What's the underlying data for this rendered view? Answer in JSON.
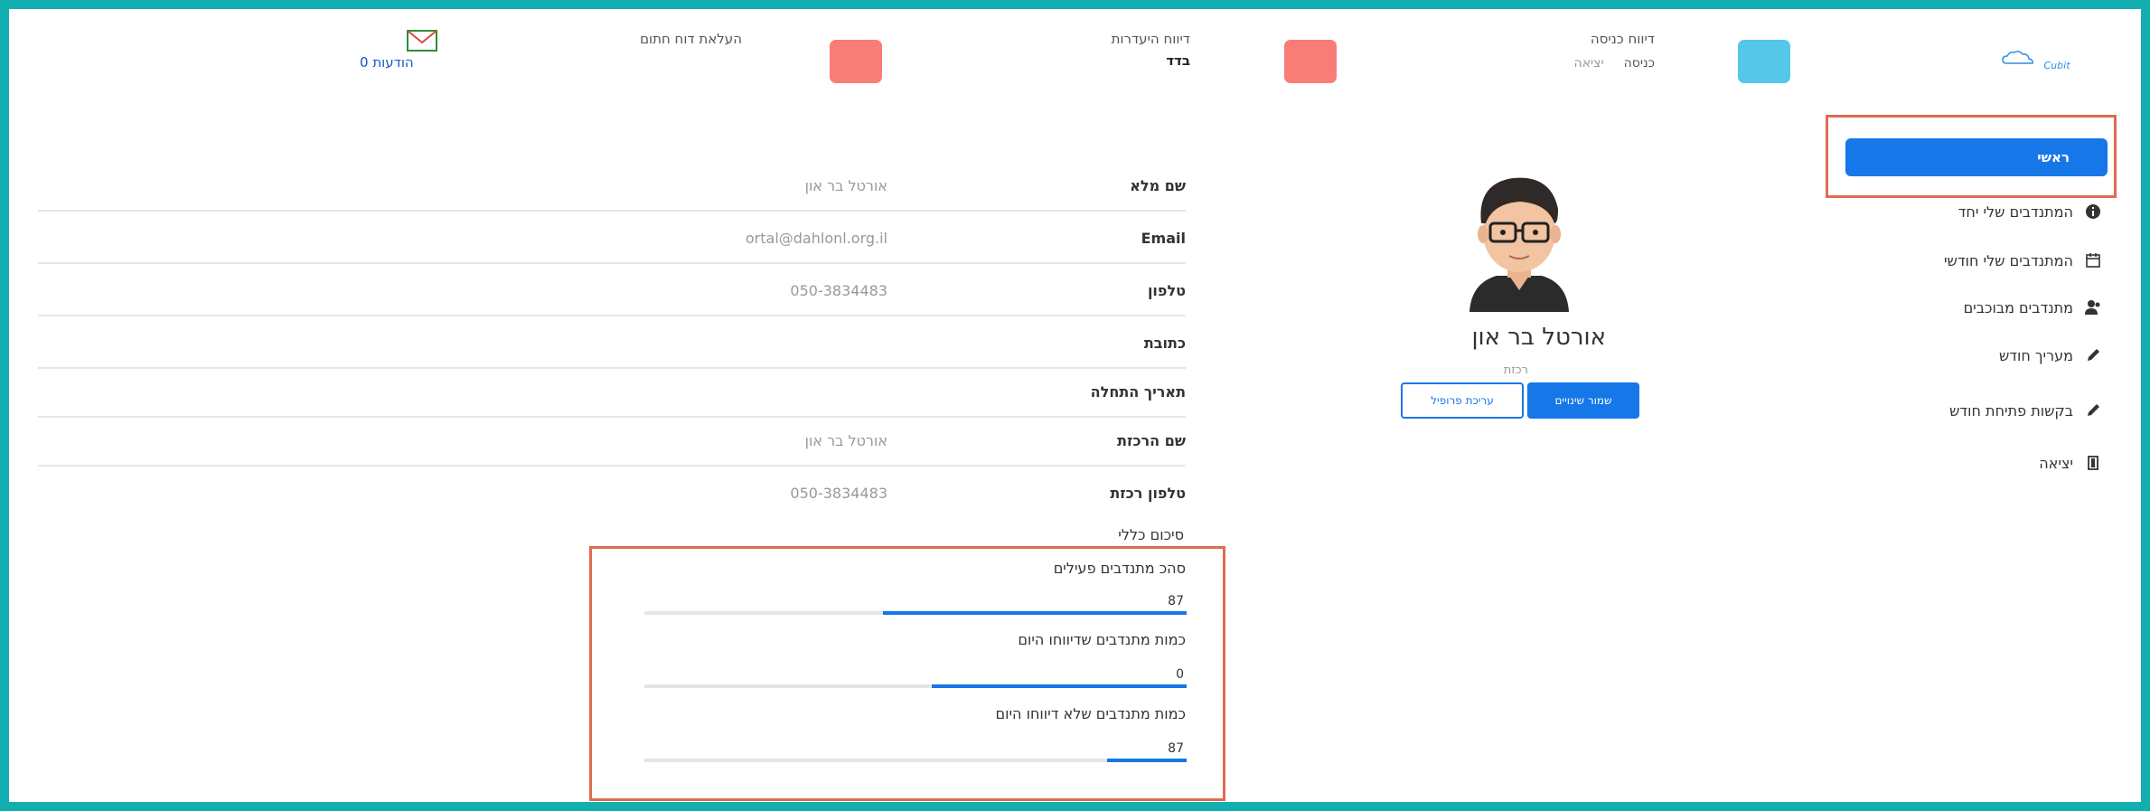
{
  "header": {
    "logo": "Cubit",
    "entry_report": {
      "label": "דיווח כניסה",
      "options": [
        "כניסה",
        "יציאה"
      ]
    },
    "absence_report": {
      "label": "דיווח היעדרות",
      "value": "בדד"
    },
    "sign_report": {
      "label": "העלאת דוח חתום"
    },
    "messages": {
      "label": "0 הודעות",
      "icon": "mail-icon"
    },
    "colors": {
      "entry_tile": "#55c8ea",
      "absence_tile": "#f87d78",
      "sign_tile": "#f87d78"
    }
  },
  "sidebar": {
    "primary_button": "ראשי",
    "items": [
      {
        "label": "המתנדבים שלי יחד",
        "icon": "info-icon"
      },
      {
        "label": "המתנדבים שלי חודשי",
        "icon": "calendar-icon"
      },
      {
        "label": "מתנדבים מבוכבים",
        "icon": "users-icon"
      },
      {
        "label": "מעריך חודש",
        "icon": "pencil-icon"
      },
      {
        "label": "בקשות פתיחת חודש",
        "icon": "pencil-icon"
      },
      {
        "label": "יציאה",
        "icon": "logout-icon"
      }
    ]
  },
  "profile": {
    "name": "אורטל בר און",
    "role": "רכזת",
    "buttons": {
      "primary": "שמור שינויים",
      "secondary": "עריכת פרופיל"
    }
  },
  "details": {
    "rows": [
      {
        "label": "שם מלא",
        "value": "אורטל בר און"
      },
      {
        "label": "Email",
        "value": "ortal@dahlonl.org.il"
      },
      {
        "label": "טלפון",
        "value": "050-3834483"
      },
      {
        "label": "כתובת",
        "value": ""
      },
      {
        "label": "תאריך התחלה",
        "value": ""
      },
      {
        "label": "שם הרכזת",
        "value": "אורטל בר און"
      },
      {
        "label": "טלפון רכזת",
        "value": "050-3834483"
      }
    ],
    "section_title": "סיכום כללי"
  },
  "stats": [
    {
      "label": "סהכ מתנדבים פעילים",
      "value": "87",
      "fill": 0.56
    },
    {
      "label": "כמות מתנדבים שדיווחו היום",
      "value": "0",
      "fill": 0.47
    },
    {
      "label": "כמות מתנדבים שלא דיווחו היום",
      "value": "87",
      "fill": 0.146
    }
  ]
}
